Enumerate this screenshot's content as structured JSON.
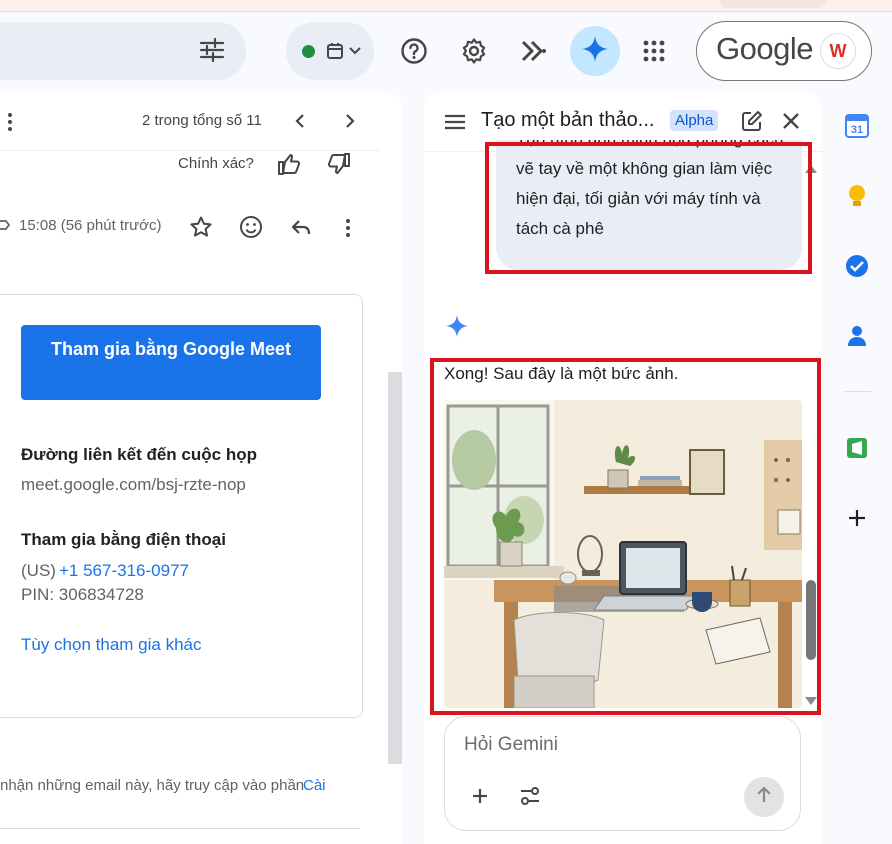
{
  "topbar": {
    "google_text": "Google",
    "avatar_text": "W",
    "icons": [
      "filter-icon",
      "calendar-icon",
      "help-icon",
      "settings-icon",
      "apps-script-icon",
      "gemini-icon",
      "apps-grid-icon"
    ]
  },
  "mail": {
    "pagination": "2 trong tổng số 11",
    "feedback_prompt": "Chính xác?",
    "timestamp": "15:08 (56 phút trước)",
    "join_button": "Tham gia bằng Google Meet",
    "link_heading": "Đường liên kết đến cuộc họp",
    "link_url": "meet.google.com/bsj-rzte-nop",
    "phone_heading": "Tham gia bằng điện thoại",
    "phone_country": "(US)",
    "phone_number": "+1 567-316-0977",
    "pin": "PIN: 306834728",
    "other_options": "Tùy chọn tham gia khác",
    "footer_text": "nhận những email này, hãy truy cập vào phần",
    "footer_link": "Cài"
  },
  "gemini": {
    "title": "Tạo một bản thảo...",
    "badge": "Alpha",
    "prompt": "Tạo hình ảnh minh họa phong cách vẽ tay về một không gian làm việc hiện đại, tối giản với máy tính và tách cà phê",
    "response": "Xong! Sau đây là một bức ảnh.",
    "input_placeholder": "Hỏi Gemini"
  },
  "rail": {
    "calendar_day": "31"
  },
  "colors": {
    "accent": "#1a73e8",
    "highlight_box": "#d9141c",
    "gemini_blue": "#0b57d0"
  }
}
